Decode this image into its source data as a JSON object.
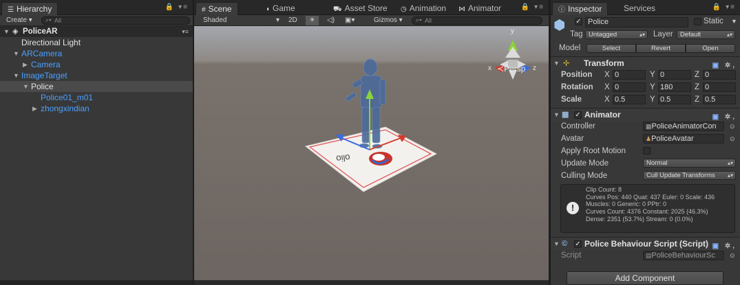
{
  "hierarchy": {
    "tab_label": "Hierarchy",
    "create_label": "Create",
    "search_placeholder": "All",
    "scene_name": "PoliceAR",
    "items": [
      {
        "label": "Directional Light",
        "color": "white"
      },
      {
        "label": "ARCamera",
        "color": "blue"
      },
      {
        "label": "Camera",
        "color": "blue"
      },
      {
        "label": "ImageTarget",
        "color": "blue"
      },
      {
        "label": "Police",
        "color": "white"
      },
      {
        "label": "Police01_m01",
        "color": "blue"
      },
      {
        "label": "zhongxindian",
        "color": "blue"
      }
    ]
  },
  "center_tabs": {
    "scene": "Scene",
    "game": "Game",
    "asset_store": "Asset Store",
    "animation": "Animation",
    "animator": "Animator"
  },
  "scene_toolbar": {
    "shading": "Shaded",
    "mode_2d": "2D",
    "gizmos": "Gizmos",
    "search_placeholder": "All"
  },
  "scene_view": {
    "projection_label": "Persp",
    "gizmo_axes": {
      "y": "y",
      "x": "x",
      "z": "z"
    },
    "colors": {
      "y": "#8bd43a",
      "x": "#d33a2c",
      "z": "#3a6be0"
    }
  },
  "inspector": {
    "tab_label": "Inspector",
    "services_label": "Services",
    "object_name": "Police",
    "static_label": "Static",
    "tag_label": "Tag",
    "tag_value": "Untagged",
    "layer_label": "Layer",
    "layer_value": "Default",
    "model_label": "Model",
    "model_buttons": [
      "Select",
      "Revert",
      "Open"
    ],
    "transform": {
      "title": "Transform",
      "position": {
        "label": "Position",
        "x": "0",
        "y": "0",
        "z": "0"
      },
      "rotation": {
        "label": "Rotation",
        "x": "0",
        "y": "180",
        "z": "0"
      },
      "scale": {
        "label": "Scale",
        "x": "0.5",
        "y": "0.5",
        "z": "0.5"
      }
    },
    "animator": {
      "title": "Animator",
      "controller_label": "Controller",
      "controller_value": "PoliceAnimatorCon",
      "avatar_label": "Avatar",
      "avatar_value": "PoliceAvatar",
      "apply_root_motion_label": "Apply Root Motion",
      "update_mode_label": "Update Mode",
      "update_mode_value": "Normal",
      "culling_mode_label": "Culling Mode",
      "culling_mode_value": "Cull Update Transforms",
      "info_lines": [
        "Clip Count: 8",
        "Curves Pos: 440 Quat: 437 Euler: 0 Scale: 436",
        "Muscles: 0 Generic: 0 PPtr: 0",
        "Curves Count: 4376 Constant: 2025 (46.3%)",
        "Dense: 2351 (53.7%) Stream: 0 (0.0%)"
      ]
    },
    "script_component": {
      "title": "Police Behaviour Script (Script)",
      "script_label": "Script",
      "script_value": "PoliceBehaviourSc"
    },
    "add_component_label": "Add Component"
  }
}
